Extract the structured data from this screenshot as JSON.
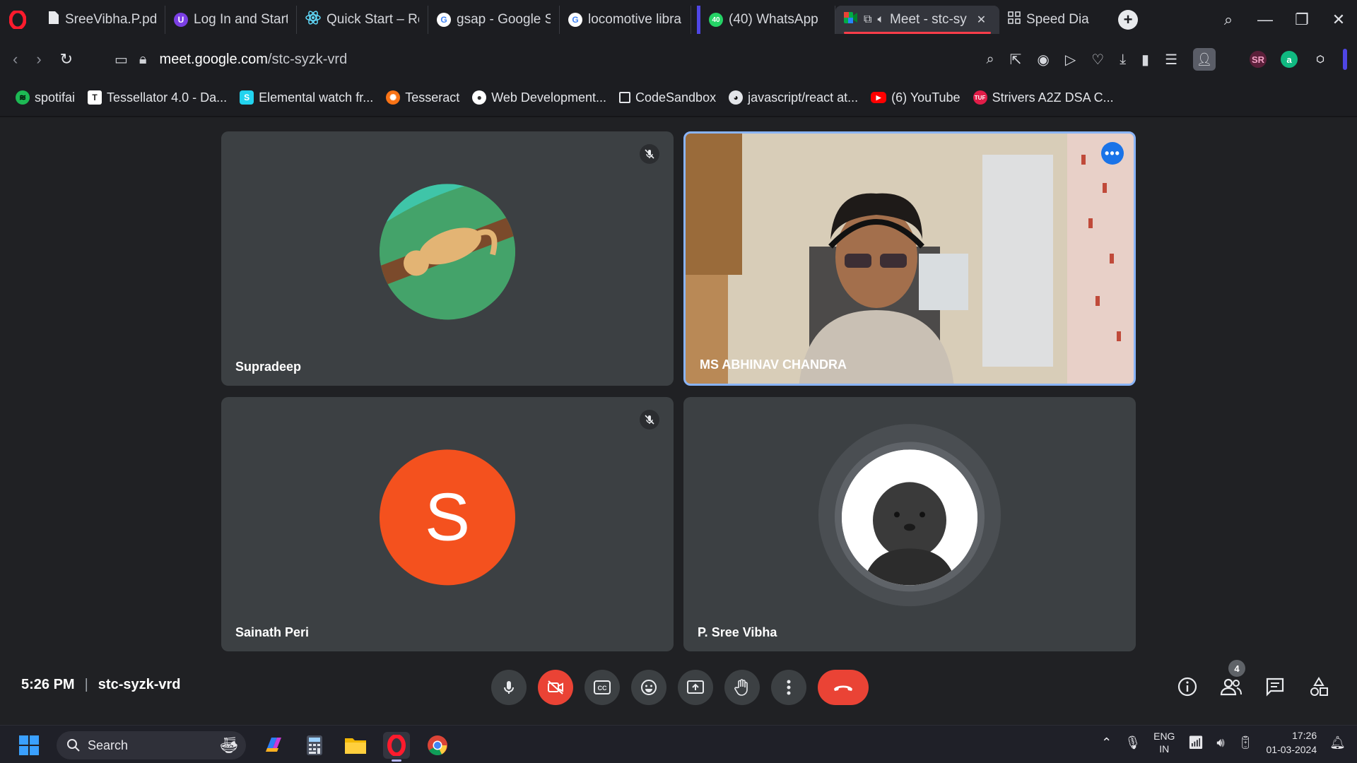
{
  "browser": {
    "tabs": [
      {
        "label": "SreeVibha.P.pdf",
        "icon": "pdf-icon"
      },
      {
        "label": "Log In and Start L",
        "icon": "login-icon"
      },
      {
        "label": "Quick Start – Reac",
        "icon": "react-icon"
      },
      {
        "label": "gsap - Google Sea",
        "icon": "google-icon"
      },
      {
        "label": "locomotive library",
        "icon": "google-icon"
      },
      {
        "label": "(40) WhatsApp",
        "icon": "whatsapp-icon",
        "badge": "40"
      },
      {
        "label": "Meet - stc-sy",
        "icon": "meet-icon",
        "active": true
      },
      {
        "label": "Speed Dial",
        "icon": "speed-dial-icon"
      }
    ],
    "url_host": "meet.google.com",
    "url_path": "/stc-syzk-vrd",
    "bookmarks": [
      {
        "label": "spotifai",
        "icon": "spotify-icon"
      },
      {
        "label": "Tessellator 4.0 - Da...",
        "icon": "tessellator-icon"
      },
      {
        "label": "Elemental watch fr...",
        "icon": "elemental-icon"
      },
      {
        "label": "Tesseract",
        "icon": "tesseract-icon"
      },
      {
        "label": "Web Development...",
        "icon": "webdev-icon"
      },
      {
        "label": "CodeSandbox",
        "icon": "codesandbox-icon"
      },
      {
        "label": "javascript/react at...",
        "icon": "github-icon"
      },
      {
        "label": "(6) YouTube",
        "icon": "youtube-icon"
      },
      {
        "label": "Strivers A2Z DSA C...",
        "icon": "striver-icon"
      }
    ],
    "extension_badge": "SR"
  },
  "meet": {
    "participants": [
      {
        "name": "Supradeep",
        "muted": true
      },
      {
        "name": "MS ABHINAV CHANDRA",
        "muted": false,
        "video_on": true
      },
      {
        "name": "Sainath Peri",
        "muted": true,
        "initial": "S"
      },
      {
        "name": "P. Sree Vibha",
        "muted": false
      }
    ],
    "time": "5:26 PM",
    "meeting_code": "stc-syzk-vrd",
    "people_count": "4"
  },
  "taskbar": {
    "search_placeholder": "Search",
    "lang_line1": "ENG",
    "lang_line2": "IN",
    "clock_time": "17:26",
    "clock_date": "01-03-2024"
  },
  "colors": {
    "meet_bg": "#202124",
    "tile_bg": "#3c4043",
    "end_call": "#ea4335",
    "speaker_outline": "#8ab4f8",
    "avatar_s": "#f4511e",
    "opera_red": "#ff1b2d"
  }
}
